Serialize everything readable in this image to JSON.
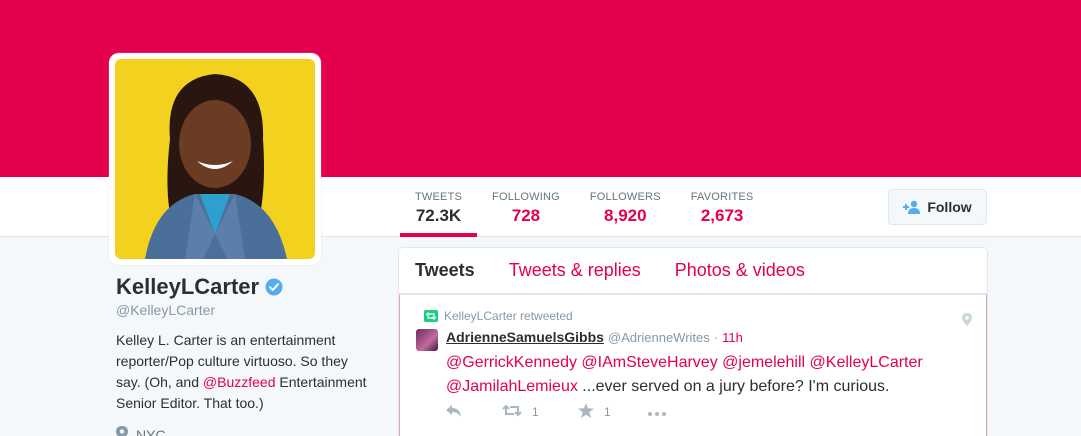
{
  "profile": {
    "display_name": "KelleyLCarter",
    "handle": "@KelleyLCarter",
    "bio_part1": "Kelley L. Carter is an entertainment reporter/Pop culture virtuoso. So they say. (Oh, and ",
    "bio_mention": "@Buzzfeed",
    "bio_part2": " Entertainment Senior Editor. That too.)",
    "location": "NYC",
    "verified_icon": "verified-badge-icon"
  },
  "stats": [
    {
      "label": "TWEETS",
      "value": "72.3K"
    },
    {
      "label": "FOLLOWING",
      "value": "728"
    },
    {
      "label": "FOLLOWERS",
      "value": "8,920"
    },
    {
      "label": "FAVORITES",
      "value": "2,673"
    }
  ],
  "follow_button": {
    "label": "Follow",
    "icon": "add-user-icon"
  },
  "tabs": [
    {
      "label": "Tweets"
    },
    {
      "label": "Tweets & replies"
    },
    {
      "label": "Photos & videos"
    }
  ],
  "tweet": {
    "context": "KelleyLCarter retweeted",
    "author": "AdrienneSamuelsGibbs",
    "username": "@AdrienneWrites",
    "separator": "·",
    "time": "11h",
    "mentions": [
      "@GerrickKennedy",
      "@IAmSteveHarvey",
      "@jemelehill",
      "@KelleyLCarter",
      "@JamilahLemieux"
    ],
    "text_rest": " ...ever served on a jury before? I'm curious.",
    "retweet_count": "1",
    "favorite_count": "1"
  },
  "colors": {
    "brand": "#e4004f",
    "retweet_green": "#19cf86",
    "verified_blue": "#55acee"
  }
}
